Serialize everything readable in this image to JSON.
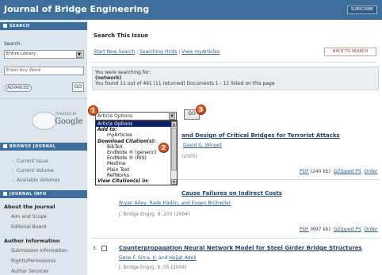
{
  "header": {
    "title": "Journal of Bridge Engineering",
    "subscribe_label": "SUBSCRIBE"
  },
  "sidebar": {
    "search_head": "SEARCH",
    "search_label": "Search:",
    "library_select": "Entire Library",
    "query_placeholder": "Enter Any Word",
    "advanced_label": "ADVANCED",
    "go_label": "GO",
    "powered_by": "POWERED BY",
    "google_label": "Google",
    "browse_head": "BROWSE JOURNAL",
    "browse_items": [
      {
        "label": "Current Issue"
      },
      {
        "label": "Current Volume"
      },
      {
        "label": "Available Volumes"
      }
    ],
    "info_head": "JOURNAL INFO",
    "about_title": "About the Journal",
    "about_items": [
      {
        "label": "Aim and Scope"
      },
      {
        "label": "Editorial Board"
      }
    ],
    "author_title": "Author Information",
    "author_items": [
      {
        "label": "Submission Information"
      },
      {
        "label": "Rights/Permissions"
      },
      {
        "label": "Author Services"
      }
    ]
  },
  "main": {
    "title": "Search This Issue",
    "links": {
      "new_search": "Start New Search",
      "hints": "Searching Hints",
      "myarticles": "View myArticles"
    },
    "back_label": "BACK TO SEARCH",
    "info": {
      "line1": "You were searching for:",
      "line2": "(network)",
      "line3": "You found 11 out of 491 (11 returned) Documents 1 - 11 listed on this page"
    },
    "options_select": "Article Options",
    "go_label": "GO",
    "dropdown": [
      {
        "label": "Article Options",
        "kind": "sel"
      },
      {
        "label": "Add to:",
        "kind": "group"
      },
      {
        "label": "myArticles",
        "kind": "ind"
      },
      {
        "label": "Download Citation(s):",
        "kind": "group"
      },
      {
        "label": "BibTeX",
        "kind": "ind"
      },
      {
        "label": "EndNote ® (generic)",
        "kind": "ind"
      },
      {
        "label": "EndNote ® (RIS)",
        "kind": "ind"
      },
      {
        "label": "Medline",
        "kind": "ind"
      },
      {
        "label": "Plain Text",
        "kind": "ind"
      },
      {
        "label": "RefWorks",
        "kind": "ind"
      },
      {
        "label": "View Citation(s) in:",
        "kind": "group"
      }
    ],
    "callouts": [
      "1",
      "2",
      "3"
    ],
    "articles": [
      {
        "title": "and Design of Critical Bridges for Terrorist Attacks",
        "authors": "David G. Winget",
        "ref": "(2005)",
        "pdf": "PDF",
        "pdf_size": "(240 kb)",
        "gz": "GZipped PS",
        "order": "Order"
      },
      {
        "title": "Cause Failures on Indirect Costs",
        "authors": "Bryan Adey, Rade Hadiin, and Eugen Brühwiler",
        "ref": "J. Bridge Engrg. 9, 200 (2004)",
        "pdf": "PDF",
        "pdf_size": "(697 kb)",
        "gz": "GZipped PS",
        "order": "Order"
      },
      {
        "number": "3.",
        "title": "Counterpropagation Neural Network Model for Steel Girder Bridge Structures",
        "author_a": "Gene F. Sirca, Jr.",
        "and_word": "and",
        "author_b": "Hojjat Adeli",
        "ref": "J. Bridge Engrg. 9, 55 (2004)"
      }
    ]
  },
  "colors": {
    "header": "#3e6e9c",
    "sidebar": "#dde5ed",
    "callout": "#d9501a",
    "link": "#2a5a8a"
  },
  "icons": {
    "chevron": "chevron-right-icon",
    "dropdown_arrow": "chevron-down-icon"
  }
}
